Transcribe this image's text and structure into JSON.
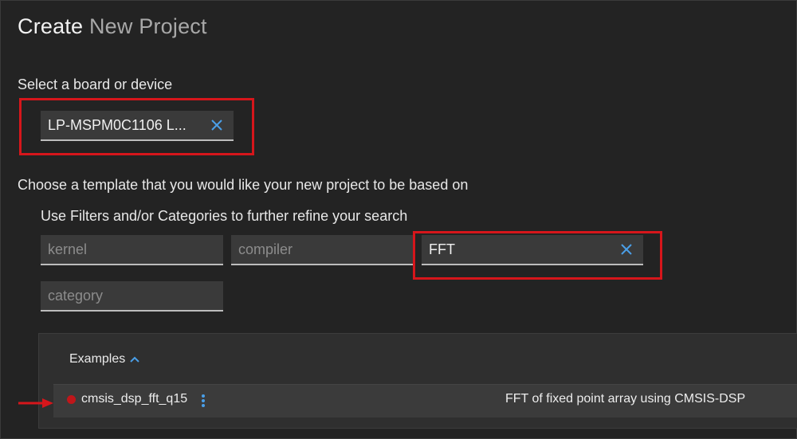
{
  "header": {
    "title_first": "Create",
    "title_rest": "New Project"
  },
  "device": {
    "label": "Select a board or device",
    "value": "LP-MSPM0C1106 L..."
  },
  "template": {
    "label": "Choose a template that you would like your new project to be based on",
    "filter_hint": "Use Filters and/or Categories to further refine your search",
    "filters": {
      "kernel_placeholder": "kernel",
      "compiler_placeholder": "compiler",
      "search_value": "FFT",
      "category_placeholder": "category"
    }
  },
  "results": {
    "section_label": "Examples",
    "items": [
      {
        "name": "cmsis_dsp_fft_q15",
        "description": "FFT of fixed point array using CMSIS-DSP"
      }
    ]
  },
  "colors": {
    "background": "#232323",
    "field": "#3a3a3a",
    "accent_blue": "#4a9fe8",
    "highlight_red": "#d6161b"
  }
}
